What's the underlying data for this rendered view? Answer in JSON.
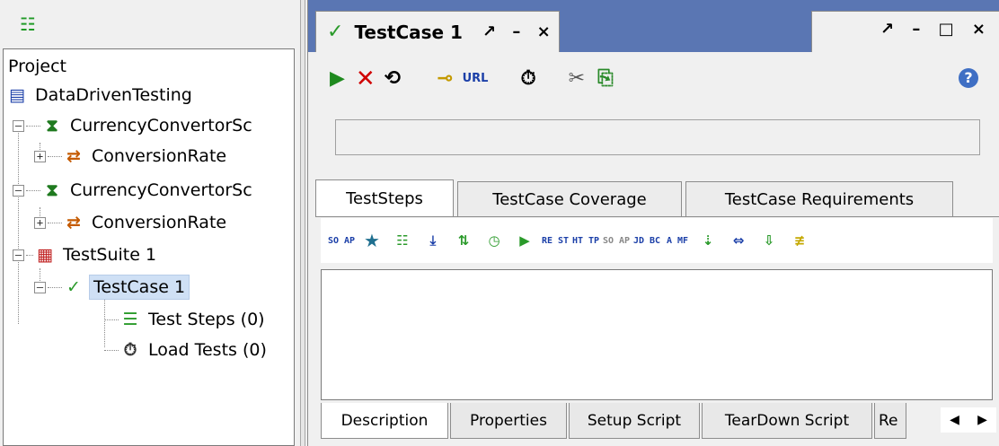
{
  "navigator": {
    "toolbar_icon": "tree-toggle-icon",
    "tree": [
      {
        "label": "Project",
        "icon": ""
      },
      {
        "label": "DataDrivenTesting",
        "icon": "project-icon"
      },
      {
        "label": "CurrencyConvertorSc",
        "icon": "interface-icon"
      },
      {
        "label": "ConversionRate",
        "icon": "operation-icon"
      },
      {
        "label": "CurrencyConvertorSc",
        "icon": "interface-icon"
      },
      {
        "label": "ConversionRate",
        "icon": "operation-icon"
      },
      {
        "label": "TestSuite 1",
        "icon": "testsuite-icon"
      },
      {
        "label": "TestCase 1",
        "icon": "testcase-icon"
      },
      {
        "label": "Test Steps (0)",
        "icon": "teststeps-icon"
      },
      {
        "label": "Load Tests (0)",
        "icon": "loadtest-icon"
      }
    ]
  },
  "editor": {
    "tab_title": "TestCase 1",
    "tab_controls": "↗ – ×",
    "window_controls": "↗ – □ ×",
    "toolbar": {
      "run_icon": "▶",
      "cancel_icon": "✕",
      "loop_icon": "⟲",
      "credentials_icon": "⊸",
      "url_label": "URL",
      "timer_icon": "⏱",
      "options_icon": "✂",
      "export_icon": "⎘",
      "help_icon": "?"
    },
    "tabs": [
      "TestSteps",
      "TestCase Coverage",
      "TestCase Requirements"
    ],
    "steps_toolbar": [
      "SO AP",
      "★",
      "☷",
      "⤓",
      "⇅",
      "◷",
      "▶",
      "RE ST",
      "HT TP",
      "SO AP",
      "JD BC",
      "A MF",
      "⇣",
      "⇔",
      "⇩",
      "≢"
    ],
    "bottom_tabs": [
      "Description",
      "Properties",
      "Setup Script",
      "TearDown Script",
      "Re"
    ],
    "bottom_scroll": {
      "left": "◀",
      "right": "▶"
    }
  }
}
